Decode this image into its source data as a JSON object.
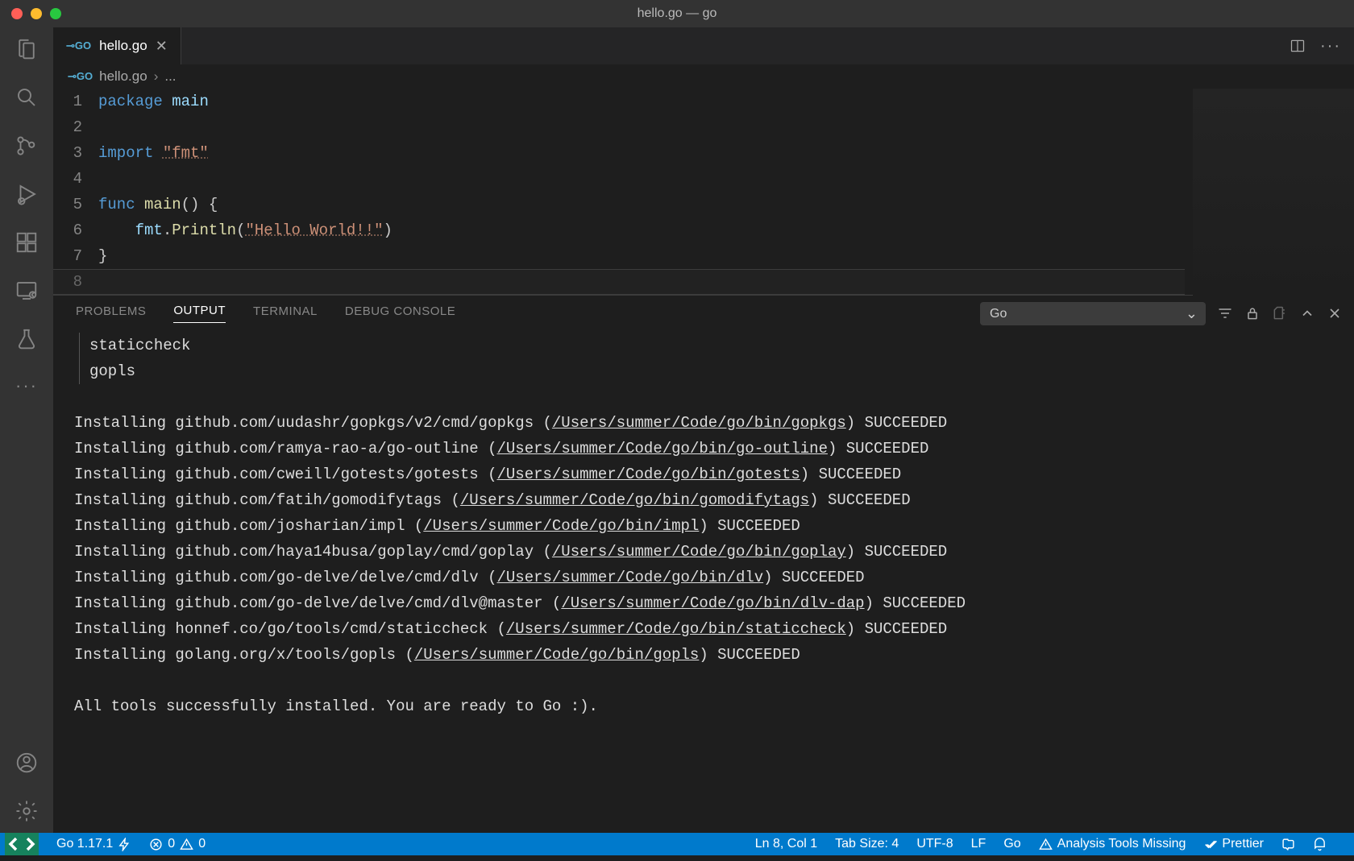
{
  "window": {
    "title": "hello.go — go"
  },
  "tab": {
    "filename": "hello.go",
    "lang_badge": "GO"
  },
  "breadcrumbs": {
    "file": "hello.go",
    "sep": "›",
    "more": "..."
  },
  "editor": {
    "line_numbers": [
      "1",
      "2",
      "3",
      "4",
      "5",
      "6",
      "7",
      "8"
    ],
    "code": {
      "l1_package": "package",
      "l1_main": "main",
      "l3_import": "import",
      "l3_fmt": "\"fmt\"",
      "l5_func": "func",
      "l5_main": "main",
      "l5_paren": "() {",
      "l6_fmt": "fmt",
      "l6_dot": ".",
      "l6_println": "Println",
      "l6_open": "(",
      "l6_str": "\"Hello World!!\"",
      "l6_close": ")",
      "l7_brace": "}"
    }
  },
  "panel_tabs": {
    "problems": "PROBLEMS",
    "output": "OUTPUT",
    "terminal": "TERMINAL",
    "debug": "DEBUG CONSOLE"
  },
  "output_channel": "Go",
  "output": {
    "tree1": "staticcheck",
    "tree2": "gopls",
    "lines": [
      {
        "pre": "Installing github.com/uudashr/gopkgs/v2/cmd/gopkgs (",
        "path": "/Users/summer/Code/go/bin/gopkgs",
        "post": ") SUCCEEDED"
      },
      {
        "pre": "Installing github.com/ramya-rao-a/go-outline (",
        "path": "/Users/summer/Code/go/bin/go-outline",
        "post": ") SUCCEEDED"
      },
      {
        "pre": "Installing github.com/cweill/gotests/gotests (",
        "path": "/Users/summer/Code/go/bin/gotests",
        "post": ") SUCCEEDED"
      },
      {
        "pre": "Installing github.com/fatih/gomodifytags (",
        "path": "/Users/summer/Code/go/bin/gomodifytags",
        "post": ") SUCCEEDED"
      },
      {
        "pre": "Installing github.com/josharian/impl (",
        "path": "/Users/summer/Code/go/bin/impl",
        "post": ") SUCCEEDED"
      },
      {
        "pre": "Installing github.com/haya14busa/goplay/cmd/goplay (",
        "path": "/Users/summer/Code/go/bin/goplay",
        "post": ") SUCCEEDED"
      },
      {
        "pre": "Installing github.com/go-delve/delve/cmd/dlv (",
        "path": "/Users/summer/Code/go/bin/dlv",
        "post": ") SUCCEEDED"
      },
      {
        "pre": "Installing github.com/go-delve/delve/cmd/dlv@master (",
        "path": "/Users/summer/Code/go/bin/dlv-dap",
        "post": ") SUCCEEDED"
      },
      {
        "pre": "Installing honnef.co/go/tools/cmd/staticcheck (",
        "path": "/Users/summer/Code/go/bin/staticcheck",
        "post": ") SUCCEEDED"
      },
      {
        "pre": "Installing golang.org/x/tools/gopls (",
        "path": "/Users/summer/Code/go/bin/gopls",
        "post": ") SUCCEEDED"
      }
    ],
    "footer": "All tools successfully installed. You are ready to Go :)."
  },
  "status": {
    "go_version": "Go 1.17.1",
    "error_count": "0",
    "warning_count": "0",
    "ln_col": "Ln 8, Col 1",
    "tab_size": "Tab Size: 4",
    "encoding": "UTF-8",
    "eol": "LF",
    "lang": "Go",
    "analysis": "Analysis Tools Missing",
    "prettier": "Prettier"
  }
}
